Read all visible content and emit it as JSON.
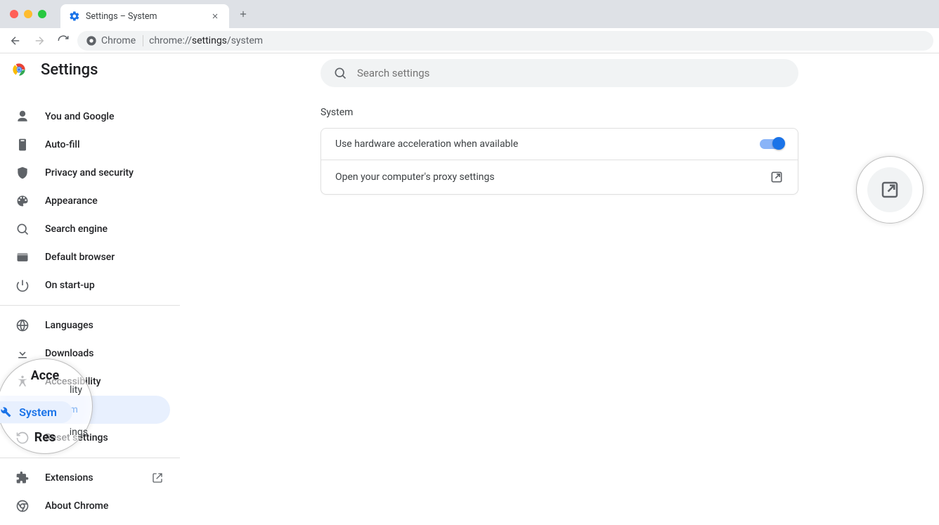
{
  "window": {
    "tab_title": "Settings – System",
    "omnibox_chip": "Chrome",
    "url_prefix": "chrome://",
    "url_bold": "settings",
    "url_suffix": "/system"
  },
  "header": {
    "title": "Settings"
  },
  "search": {
    "placeholder": "Search settings"
  },
  "sidebar": {
    "items": [
      {
        "label": "You and Google",
        "icon": "person"
      },
      {
        "label": "Auto-fill",
        "icon": "clipboard"
      },
      {
        "label": "Privacy and security",
        "icon": "shield"
      },
      {
        "label": "Appearance",
        "icon": "palette"
      },
      {
        "label": "Search engine",
        "icon": "search"
      },
      {
        "label": "Default browser",
        "icon": "browser"
      },
      {
        "label": "On start-up",
        "icon": "power"
      }
    ],
    "advanced": [
      {
        "label": "Languages",
        "icon": "globe"
      },
      {
        "label": "Downloads",
        "icon": "download"
      },
      {
        "label": "Accessibility",
        "icon": "accessibility"
      },
      {
        "label": "System",
        "icon": "wrench",
        "selected": true
      },
      {
        "label": "Reset settings",
        "icon": "reset"
      }
    ],
    "footer": [
      {
        "label": "Extensions",
        "icon": "puzzle",
        "external": true
      },
      {
        "label": "About Chrome",
        "icon": "chrome"
      }
    ]
  },
  "main": {
    "section_title": "System",
    "rows": [
      {
        "label": "Use hardware acceleration when available",
        "control": "toggle_on"
      },
      {
        "label": "Open your computer's proxy settings",
        "control": "launch"
      }
    ]
  },
  "magnifiers": {
    "m1_top": "Acce",
    "m1_top_suffix": "lity",
    "m1_system": "System",
    "m1_bottom": "Res",
    "m1_bottom_suffix": "ings"
  }
}
